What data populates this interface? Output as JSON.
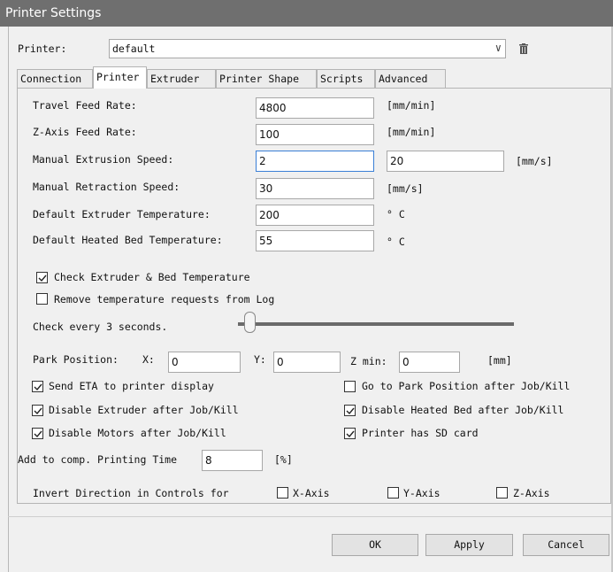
{
  "window": {
    "title": "Printer Settings"
  },
  "printer": {
    "label": "Printer:",
    "value": "default"
  },
  "tabs": [
    {
      "label": "Connection"
    },
    {
      "label": "Printer"
    },
    {
      "label": "Extruder"
    },
    {
      "label": "Printer Shape"
    },
    {
      "label": "Scripts"
    },
    {
      "label": "Advanced"
    }
  ],
  "active_tab": "Printer",
  "fields": {
    "travel_feed": {
      "label": "Travel Feed Rate:",
      "value": "4800",
      "unit": "[mm/min]"
    },
    "z_feed": {
      "label": "Z-Axis Feed Rate:",
      "value": "100",
      "unit": "[mm/min]"
    },
    "manual_extrusion": {
      "label": "Manual Extrusion Speed:",
      "value": "2",
      "value2": "20",
      "unit": "[mm/s]"
    },
    "manual_retraction": {
      "label": "Manual Retraction Speed:",
      "value": "30",
      "unit": "[mm/s]"
    },
    "extruder_temp": {
      "label": "Default Extruder Temperature:",
      "value": "200",
      "unit": "° C"
    },
    "bed_temp": {
      "label": "Default Heated Bed Temperature:",
      "value": "55",
      "unit": "° C"
    }
  },
  "checks": {
    "check_temp": {
      "label": "Check Extruder & Bed Temperature",
      "checked": true
    },
    "remove_temp": {
      "label": "Remove temperature requests from Log",
      "checked": false
    },
    "send_eta": {
      "label": "Send ETA to printer display",
      "checked": true
    },
    "goto_park": {
      "label": "Go to Park Position after Job/Kill",
      "checked": false
    },
    "disable_extruder": {
      "label": "Disable Extruder after Job/Kill",
      "checked": true
    },
    "disable_bed": {
      "label": "Disable Heated Bed after Job/Kill",
      "checked": true
    },
    "disable_motors": {
      "label": "Disable Motors after Job/Kill",
      "checked": true
    },
    "sd_card": {
      "label": "Printer has SD card",
      "checked": true
    }
  },
  "check_every": {
    "label": "Check every 3 seconds.",
    "slider_fraction": 0.05
  },
  "park": {
    "label": "Park Position:",
    "x_label": "X:",
    "x": "0",
    "y_label": "Y:",
    "y": "0",
    "zmin_label": "Z min:",
    "zmin": "0",
    "unit": "[mm]"
  },
  "comp_time": {
    "label": "Add to comp. Printing Time",
    "value": "8",
    "unit": "[%]"
  },
  "invert": {
    "label": "Invert Direction in Controls for",
    "x": {
      "label": "X-Axis",
      "checked": false
    },
    "y": {
      "label": "Y-Axis",
      "checked": false
    },
    "z": {
      "label": "Z-Axis",
      "checked": false
    }
  },
  "buttons": {
    "ok": "OK",
    "apply": "Apply",
    "cancel": "Cancel"
  },
  "icons": {
    "trash": "trash-icon",
    "dropdown": "chevron-down-icon"
  }
}
